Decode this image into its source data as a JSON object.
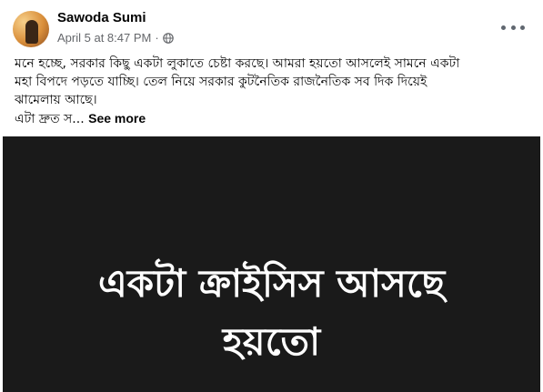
{
  "post": {
    "author": "Sawoda Sumi",
    "date": "April 5 at 8:47 PM",
    "separator": "·",
    "privacy_icon": "globe-icon",
    "more_icon": "more-options-icon",
    "caption_lines": [
      "মনে হচ্ছে, সরকার কিছু একটা লুকাতে চেষ্টা করছে। আমরা হয়তো আসলেই সামনে একটা",
      "মহা বিপদে পড়তে যাচ্ছি। তেল নিয়ে সরকার কুটনৈতিক রাজনৈতিক সব দিক দিয়েই",
      "ঝামেলায় আছে।"
    ],
    "caption_truncated": "এটা দ্রুত স...",
    "see_more": "See more"
  },
  "media": {
    "line1": "একটা ক্রাইসিস আসছে",
    "line2": "হয়তো",
    "background": "#1a1a1a",
    "text_color": "#ffffff"
  }
}
